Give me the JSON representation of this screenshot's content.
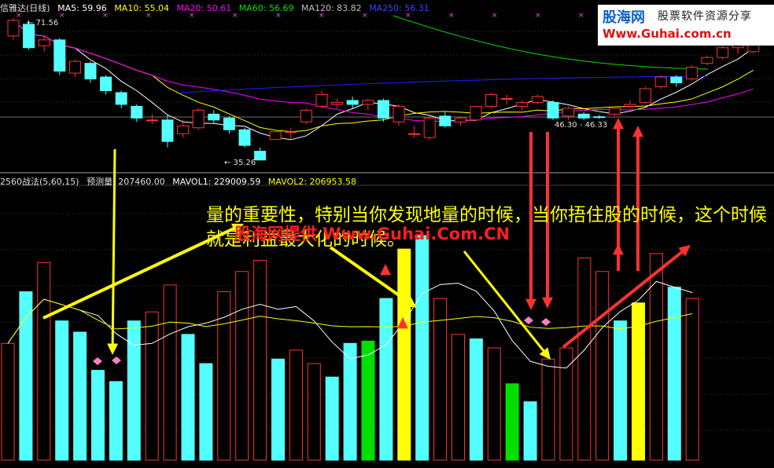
{
  "price_header": {
    "name": "信雅达(日线)",
    "ma5": "MA5: 59.96",
    "ma10": "MA10: 55.04",
    "ma20": "MA20: 50.61",
    "ma60": "MA60: 56.69",
    "ma120": "MA120: 83.82",
    "ma250": "MA250: 56.31"
  },
  "volume_header": {
    "name": "2560战法(5,60,15)",
    "forecast": "预测量: 207460.00",
    "mavol1": "MAVOL1: 229009.59",
    "mavol2": "MAVOL2: 206953.58"
  },
  "annotation": {
    "text": "量的重要性，特别当你发现地量的时候，当你捂住股的时候，这个时候就是利益最大化的时候。",
    "watermark": "股海网提供 Www.Guhai.Com.CN"
  },
  "logo": {
    "site": "股海网",
    "tagline": "股票软件资源分享",
    "url": "Www.Guhai.com.cn"
  },
  "price_labels": {
    "high": "71.56",
    "low": "35.26",
    "range": "46.30 - 46.33"
  },
  "colors": {
    "up": "#ff3232",
    "down": "#54ffff",
    "ma5": "#ffffff",
    "ma10": "#ffff00",
    "ma20": "#ff00ff",
    "ma60": "#00e000",
    "ma120": "#c0c0c0",
    "ma250": "#2020ff",
    "vol_yellow": "#ffff00",
    "vol_green": "#00e000",
    "arrow_yellow": "#ffff00",
    "arrow_red": "#ff3232"
  },
  "chart_data": {
    "type": "candlestick",
    "ylim_price": [
      33,
      73
    ],
    "candles": [
      {
        "o": 67.0,
        "c": 71.0,
        "h": 71.56,
        "l": 66.0
      },
      {
        "o": 70.0,
        "c": 64.0,
        "h": 71.0,
        "l": 63.5
      },
      {
        "o": 64.5,
        "c": 66.0,
        "h": 67.0,
        "l": 63.0
      },
      {
        "o": 66.0,
        "c": 58.0,
        "h": 66.5,
        "l": 57.0
      },
      {
        "o": 57.5,
        "c": 60.5,
        "h": 61.0,
        "l": 56.5
      },
      {
        "o": 60.0,
        "c": 56.0,
        "h": 60.5,
        "l": 55.0
      },
      {
        "o": 56.5,
        "c": 53.0,
        "h": 57.0,
        "l": 52.0
      },
      {
        "o": 52.5,
        "c": 49.5,
        "h": 53.0,
        "l": 48.5
      },
      {
        "o": 49.0,
        "c": 46.0,
        "h": 49.5,
        "l": 45.0
      },
      {
        "o": 45.5,
        "c": 45.5,
        "h": 47.0,
        "l": 44.5
      },
      {
        "o": 45.5,
        "c": 40.0,
        "h": 47.0,
        "l": 38.5
      },
      {
        "o": 42.0,
        "c": 44.0,
        "h": 45.5,
        "l": 41.0
      },
      {
        "o": 43.5,
        "c": 48.0,
        "h": 48.5,
        "l": 43.0
      },
      {
        "o": 47.0,
        "c": 45.5,
        "h": 48.0,
        "l": 44.5
      },
      {
        "o": 46.0,
        "c": 43.0,
        "h": 46.5,
        "l": 42.0
      },
      {
        "o": 43.0,
        "c": 39.0,
        "h": 43.5,
        "l": 38.5
      },
      {
        "o": 37.5,
        "c": 35.26,
        "h": 38.5,
        "l": 35.26
      },
      {
        "o": 40.5,
        "c": 42.5,
        "h": 43.0,
        "l": 40.5
      },
      {
        "o": 42.5,
        "c": 42.5,
        "h": 43.5,
        "l": 40.5
      },
      {
        "o": 45.0,
        "c": 48.0,
        "h": 48.5,
        "l": 44.5
      },
      {
        "o": 49.0,
        "c": 52.0,
        "h": 53.0,
        "l": 48.5
      },
      {
        "o": 49.5,
        "c": 50.0,
        "h": 51.0,
        "l": 48.5
      },
      {
        "o": 50.5,
        "c": 49.5,
        "h": 51.5,
        "l": 48.5
      },
      {
        "o": 49.5,
        "c": 50.5,
        "h": 51.0,
        "l": 48.0
      },
      {
        "o": 50.5,
        "c": 46.0,
        "h": 51.0,
        "l": 45.0
      },
      {
        "o": 45.0,
        "c": 49.0,
        "h": 49.5,
        "l": 44.0
      },
      {
        "o": 42.0,
        "c": 42.0,
        "h": 44.0,
        "l": 41.0
      },
      {
        "o": 41.0,
        "c": 46.0,
        "h": 46.5,
        "l": 40.5
      },
      {
        "o": 46.5,
        "c": 44.0,
        "h": 47.5,
        "l": 43.5
      },
      {
        "o": 45.0,
        "c": 46.0,
        "h": 46.5,
        "l": 44.0
      },
      {
        "o": 45.5,
        "c": 49.0,
        "h": 49.0,
        "l": 45.0
      },
      {
        "o": 49.0,
        "c": 52.0,
        "h": 52.5,
        "l": 48.5
      },
      {
        "o": 51.0,
        "c": 51.0,
        "h": 52.0,
        "l": 49.5
      },
      {
        "o": 49.0,
        "c": 50.0,
        "h": 50.5,
        "l": 48.0
      },
      {
        "o": 50.0,
        "c": 51.5,
        "h": 52.0,
        "l": 49.5
      },
      {
        "o": 50.0,
        "c": 46.0,
        "h": 50.5,
        "l": 45.5
      },
      {
        "o": 46.5,
        "c": 48.5,
        "h": 49.0,
        "l": 45.5
      },
      {
        "o": 47.0,
        "c": 46.0,
        "h": 47.5,
        "l": 45.5
      },
      {
        "o": 46.33,
        "c": 46.3,
        "h": 46.8,
        "l": 45.8
      },
      {
        "o": 47.0,
        "c": 48.5,
        "h": 49.0,
        "l": 46.5
      },
      {
        "o": 49.0,
        "c": 49.5,
        "h": 50.5,
        "l": 48.5
      },
      {
        "o": 50.0,
        "c": 53.5,
        "h": 54.0,
        "l": 49.5
      },
      {
        "o": 54.0,
        "c": 56.5,
        "h": 57.0,
        "l": 53.5
      },
      {
        "o": 56.5,
        "c": 55.0,
        "h": 57.0,
        "l": 54.0
      },
      {
        "o": 56.0,
        "c": 59.0,
        "h": 59.5,
        "l": 55.5
      },
      {
        "o": 60.0,
        "c": 61.5,
        "h": 62.0,
        "l": 59.5
      },
      {
        "o": 61.5,
        "c": 64.0,
        "h": 64.5,
        "l": 61.0
      },
      {
        "o": 64.0,
        "c": 66.0,
        "h": 67.0,
        "l": 62.5
      },
      {
        "o": 63.0,
        "c": 69.0,
        "h": 70.0,
        "l": 62.5
      }
    ],
    "volume": [
      {
        "v": 0.52,
        "c": "up"
      },
      {
        "v": 0.75,
        "c": "down"
      },
      {
        "v": 0.88,
        "c": "up"
      },
      {
        "v": 0.62,
        "c": "down"
      },
      {
        "v": 0.57,
        "c": "down"
      },
      {
        "v": 0.4,
        "c": "down"
      },
      {
        "v": 0.35,
        "c": "down"
      },
      {
        "v": 0.62,
        "c": "down"
      },
      {
        "v": 0.66,
        "c": "up"
      },
      {
        "v": 0.78,
        "c": "up"
      },
      {
        "v": 0.56,
        "c": "down"
      },
      {
        "v": 0.43,
        "c": "down"
      },
      {
        "v": 0.75,
        "c": "up"
      },
      {
        "v": 0.84,
        "c": "up"
      },
      {
        "v": 0.89,
        "c": "up"
      },
      {
        "v": 0.45,
        "c": "down"
      },
      {
        "v": 0.49,
        "c": "up"
      },
      {
        "v": 0.43,
        "c": "up"
      },
      {
        "v": 0.37,
        "c": "down"
      },
      {
        "v": 0.52,
        "c": "down"
      },
      {
        "v": 0.53,
        "c": "green"
      },
      {
        "v": 0.72,
        "c": "down"
      },
      {
        "v": 0.94,
        "c": "yellow"
      },
      {
        "v": 1.0,
        "c": "down"
      },
      {
        "v": 0.72,
        "c": "up"
      },
      {
        "v": 0.56,
        "c": "up"
      },
      {
        "v": 0.54,
        "c": "down"
      },
      {
        "v": 0.5,
        "c": "up"
      },
      {
        "v": 0.34,
        "c": "green"
      },
      {
        "v": 0.26,
        "c": "down"
      },
      {
        "v": 0.45,
        "c": "up"
      },
      {
        "v": 0.5,
        "c": "up"
      },
      {
        "v": 0.9,
        "c": "up"
      },
      {
        "v": 0.84,
        "c": "up"
      },
      {
        "v": 0.62,
        "c": "down"
      },
      {
        "v": 0.7,
        "c": "yellow"
      },
      {
        "v": 0.92,
        "c": "up"
      },
      {
        "v": 0.77,
        "c": "down"
      },
      {
        "v": 0.72,
        "c": "up"
      }
    ],
    "vol_ylim": [
      0,
      1
    ]
  }
}
